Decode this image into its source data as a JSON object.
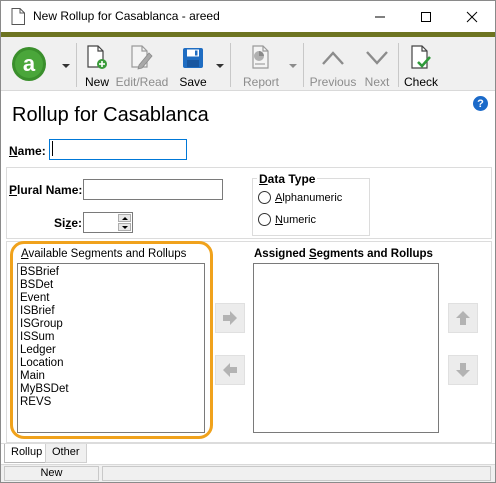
{
  "window": {
    "title": "New Rollup for Casablanca - areed",
    "icons": [
      "document-icon",
      "minimize-icon",
      "maximize-icon",
      "close-icon"
    ]
  },
  "ribbon": {
    "app_logo_letter": "a",
    "new_label": "New",
    "edit_read_label": "Edit/Read",
    "save_label": "Save",
    "report_label": "Report",
    "previous_label": "Previous",
    "next_label": "Next",
    "check_label": "Check"
  },
  "colors": {
    "accent_bar": "#6d7421",
    "logo_green": "#3a8f2c",
    "highlight_ring": "#f0a21c",
    "help_blue": "#1b6ac9"
  },
  "header": {
    "title": "Rollup for Casablanca",
    "help_glyph": "?"
  },
  "form": {
    "name_label": "Name:",
    "name_value": "",
    "plural_name_label": "Plural Name:",
    "plural_name_value": "",
    "size_label": "Size:",
    "size_value": "",
    "data_type": {
      "title": "Data Type",
      "options": [
        "Alphanumeric",
        "Numeric"
      ]
    }
  },
  "segments": {
    "available_label": "Available Segments and Rollups",
    "assigned_label": "Assigned Segments and Rollups",
    "available_items": [
      "BSBrief",
      "BSDet",
      "Event",
      "ISBrief",
      "ISGroup",
      "ISSum",
      "Ledger",
      "Location",
      "Main",
      "MyBSDet",
      "REVS"
    ],
    "assigned_items": []
  },
  "tabs": [
    "Rollup",
    "Other"
  ],
  "status": {
    "mode": "New"
  }
}
